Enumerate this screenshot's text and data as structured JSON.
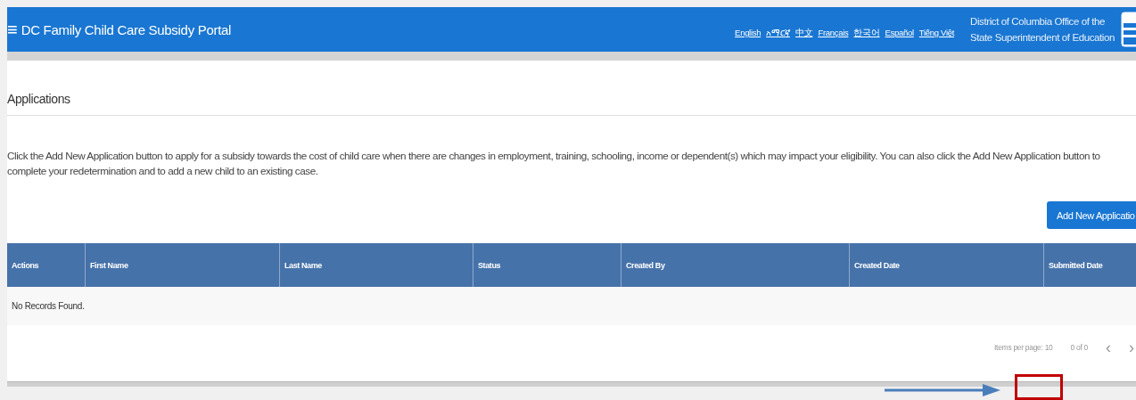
{
  "header": {
    "menu_icon": "≡",
    "title": "DC Family Child Care Subsidy Portal",
    "languages": [
      "English",
      "አማርኛ",
      "中文",
      "Français",
      "한국어",
      "Español",
      "Tiếng Việt"
    ],
    "agency_lines": [
      "District of Columbia Office of the",
      "State Superintendent of Education"
    ]
  },
  "page": {
    "title": "Applications",
    "description": "Click the Add New Application button to apply for a subsidy towards the cost of child care when there are changes in employment, training, schooling, income or dependent(s) which may impact your eligibility. You can also click the Add New Application button to complete your redetermination and to add a new child to an existing case.",
    "add_button": "Add New Applicatio"
  },
  "table": {
    "columns": [
      "Actions",
      "First Name",
      "Last Name",
      "Status",
      "Created By",
      "Created Date",
      "Submitted Date"
    ],
    "empty_message": "No Records Found."
  },
  "paginator": {
    "items_per_page_label": "Items per page:",
    "items_per_page": "10",
    "range": "0 of 0",
    "prev_icon": "‹",
    "next_icon": "›"
  }
}
